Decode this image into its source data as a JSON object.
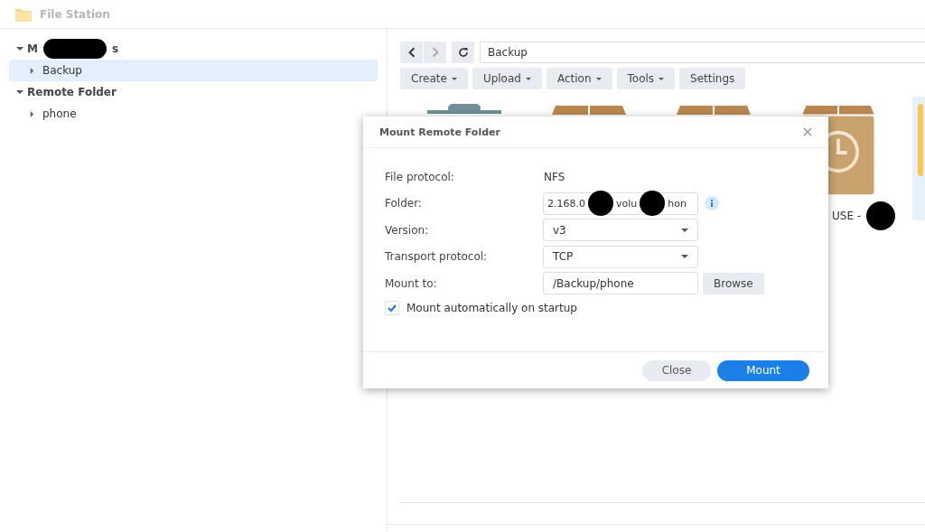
{
  "window": {
    "title": "File Station"
  },
  "sidebar": {
    "sections": [
      {
        "label_parts": [
          "M",
          "s"
        ],
        "expanded": true,
        "items": [
          {
            "label": "Backup",
            "selected": true
          }
        ]
      },
      {
        "label_parts": [
          "Remote Folder"
        ],
        "expanded": true,
        "items": [
          {
            "label": "phone",
            "selected": false
          }
        ]
      }
    ]
  },
  "toolbar": {
    "path": "Backup",
    "buttons": [
      {
        "label": "Create",
        "menu": true
      },
      {
        "label": "Upload",
        "menu": true
      },
      {
        "label": "Action",
        "menu": true
      },
      {
        "label": "Tools",
        "menu": true
      },
      {
        "label": "Settings",
        "menu": false
      }
    ]
  },
  "files": [
    {
      "kind": "drive"
    },
    {
      "kind": "folder"
    },
    {
      "kind": "folder"
    },
    {
      "kind": "clock-folder",
      "label": "USE -"
    }
  ],
  "dialog": {
    "title": "Mount Remote Folder",
    "fields": [
      {
        "kind": "text",
        "label": "File protocol:",
        "value": "NFS"
      },
      {
        "kind": "redacted-input",
        "label": "Folder:",
        "parts": [
          "2.168.0",
          "volu",
          "hon"
        ],
        "info": true
      },
      {
        "kind": "select",
        "label": "Version:",
        "value": "v3"
      },
      {
        "kind": "select",
        "label": "Transport protocol:",
        "value": "TCP"
      },
      {
        "kind": "browse",
        "label": "Mount to:",
        "value": "/Backup/phone",
        "button": "Browse"
      }
    ],
    "checkbox": {
      "label": "Mount automatically on startup",
      "checked": true
    },
    "buttons": [
      {
        "label": "Close",
        "primary": false
      },
      {
        "label": "Mount",
        "primary": true
      }
    ]
  }
}
